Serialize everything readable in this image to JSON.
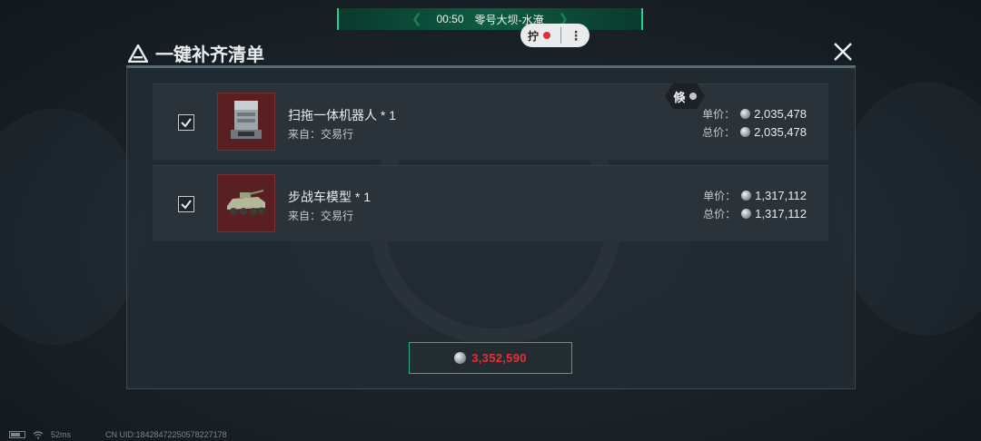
{
  "top_bar": {
    "time": "00:50",
    "map": "零号大坝-水淹"
  },
  "rec_pill": {
    "label": "拧"
  },
  "dialog": {
    "title": "一键补齐清单"
  },
  "hex_badge": {
    "label": "倏"
  },
  "items": [
    {
      "name": "扫拖一体机器人 * 1",
      "source": "来自：交易行",
      "unit_label": "单价：",
      "unit_price": "2,035,478",
      "total_label": "总价：",
      "total_price": "2,035,478",
      "checked": true
    },
    {
      "name": "步战车模型 * 1",
      "source": "来自：交易行",
      "unit_label": "单价：",
      "unit_price": "1,317,112",
      "total_label": "总价：",
      "total_price": "1,317,112",
      "checked": true
    }
  ],
  "footer": {
    "total": "3,352,590"
  },
  "status": {
    "ping": "52ms",
    "uid": "CN UID:18428472250578227178"
  },
  "colors": {
    "accent": "#27b37d",
    "price_red": "#e2323a",
    "item_bg": "#5a1f22"
  }
}
